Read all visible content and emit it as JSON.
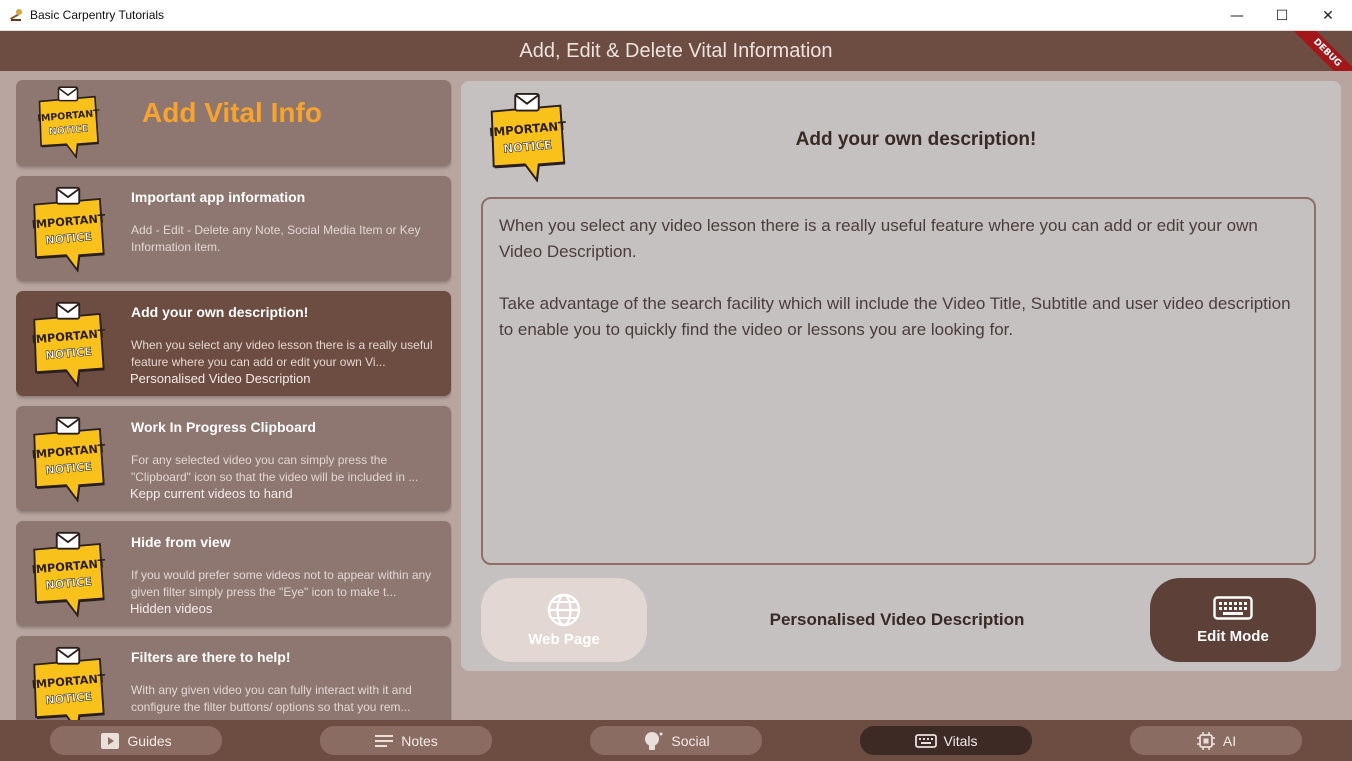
{
  "window": {
    "title": "Basic Carpentry Tutorials",
    "controls": {
      "minimize": "—",
      "maximize": "☐",
      "close": "✕"
    }
  },
  "header": {
    "title": "Add, Edit & Delete Vital Information",
    "debug_banner": "DEBUG"
  },
  "list": {
    "header_label": "Add Vital Info",
    "items": [
      {
        "title": "Important app information",
        "description": "Add - Edit - Delete any Note, Social Media Item or Key Information item.",
        "subtitle": ""
      },
      {
        "title": "Add your own description!",
        "description": "When you select any video lesson there is a really useful feature where you can add or edit your own Vi...",
        "subtitle": "Personalised Video Description"
      },
      {
        "title": "Work In Progress Clipboard",
        "description": "For any selected video you can simply press the \"Clipboard\" icon so that the video will be included in ...",
        "subtitle": "Kepp current videos to hand"
      },
      {
        "title": "Hide from view",
        "description": "If you would prefer some videos not to appear within any given filter simply press the \"Eye\" icon to make t...",
        "subtitle": "Hidden videos"
      },
      {
        "title": "Filters are there to help!",
        "description": "With any given video you can fully interact with it and configure the filter buttons/ options so that you rem...",
        "subtitle": ""
      }
    ]
  },
  "detail": {
    "title": "Add your own description!",
    "body": "When you select any video lesson there is a really useful feature where you can add or edit your own Video Description.\n\nTake advantage of the search facility which will include the Video Title, Subtitle and user video description to enable you to quickly find the video or lessons you are looking for.",
    "web_button": "Web Page",
    "caption": "Personalised Video Description",
    "edit_button": "Edit Mode"
  },
  "nav": {
    "items": [
      {
        "label": "Guides",
        "icon": "play-icon"
      },
      {
        "label": "Notes",
        "icon": "notes-icon"
      },
      {
        "label": "Social",
        "icon": "lightbulb-icon"
      },
      {
        "label": "Vitals",
        "icon": "keyboard-icon",
        "active": true
      },
      {
        "label": "AI",
        "icon": "chip-icon"
      }
    ]
  },
  "badge": {
    "line1": "IMPORTANT",
    "line2": "NOTICE"
  },
  "colors": {
    "app_brown": "#6d4c41",
    "card": "#8e7771",
    "selected_card": "#6d4c41",
    "accent_orange": "#f7a32e",
    "badge_yellow": "#f9c21b",
    "panel": "#c4c1c0"
  }
}
